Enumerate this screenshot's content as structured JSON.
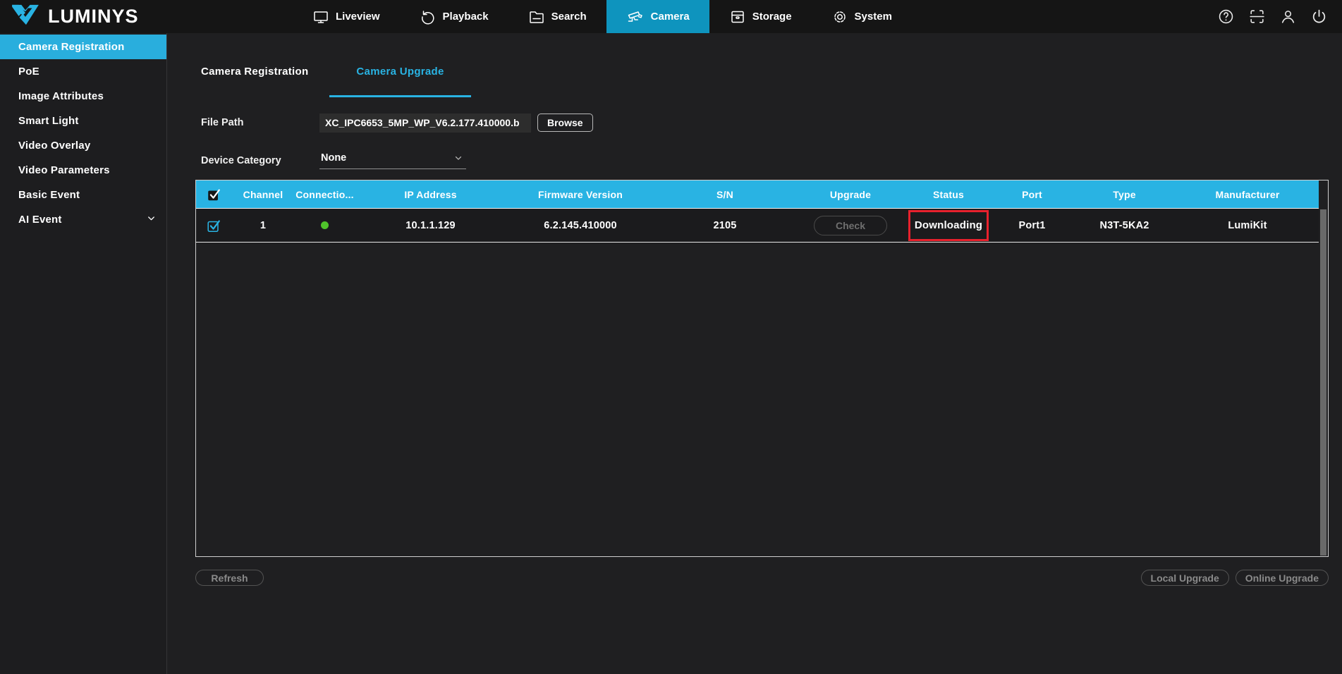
{
  "brand": {
    "logo_text": "LUMINYS"
  },
  "topnav": {
    "items": [
      {
        "label": "Liveview",
        "icon": "monitor-icon",
        "active": false
      },
      {
        "label": "Playback",
        "icon": "playback-icon",
        "active": false
      },
      {
        "label": "Search",
        "icon": "search-folder-icon",
        "active": false
      },
      {
        "label": "Camera",
        "icon": "cctv-camera-icon",
        "active": true
      },
      {
        "label": "Storage",
        "icon": "storage-box-icon",
        "active": false
      },
      {
        "label": "System",
        "icon": "gear-icon",
        "active": false
      }
    ],
    "utility_icons": [
      "help-icon",
      "fullscreen-icon",
      "user-icon",
      "power-icon"
    ]
  },
  "sidebar": {
    "items": [
      {
        "label": "Camera Registration",
        "active": true
      },
      {
        "label": "PoE",
        "active": false
      },
      {
        "label": "Image Attributes",
        "active": false
      },
      {
        "label": "Smart Light",
        "active": false
      },
      {
        "label": "Video Overlay",
        "active": false
      },
      {
        "label": "Video Parameters",
        "active": false
      },
      {
        "label": "Basic Event",
        "active": false
      },
      {
        "label": "AI Event",
        "active": false,
        "expandable": true
      }
    ]
  },
  "tabs": [
    {
      "label": "Camera Registration",
      "active": false
    },
    {
      "label": "Camera Upgrade",
      "active": true
    }
  ],
  "form": {
    "file_path": {
      "label": "File Path",
      "value": "XC_IPC6653_5MP_WP_V6.2.177.410000.b",
      "browse_label": "Browse"
    },
    "device_category": {
      "label": "Device Category",
      "value": "None"
    }
  },
  "table": {
    "columns": [
      "Channel",
      "Connectio...",
      "IP Address",
      "Firmware Version",
      "S/N",
      "Upgrade",
      "Status",
      "Port",
      "Type",
      "Manufacturer"
    ],
    "rows": [
      {
        "selected": true,
        "channel": "1",
        "connection_status": "online",
        "ip_address": "10.1.1.129",
        "firmware_version": "6.2.145.410000",
        "serial_number": "2105",
        "upgrade_action": "Check",
        "status": "Downloading",
        "status_highlighted": true,
        "port": "Port1",
        "type": "N3T-5KA2",
        "manufacturer": "LumiKit"
      }
    ]
  },
  "footer": {
    "refresh_label": "Refresh",
    "local_upgrade_label": "Local Upgrade",
    "online_upgrade_label": "Online Upgrade"
  },
  "colors": {
    "accent_cyan": "#29b3e3",
    "nav_active_cyan": "#0e94be",
    "status_green": "#4fc32b",
    "highlight_red": "#e8212d"
  }
}
